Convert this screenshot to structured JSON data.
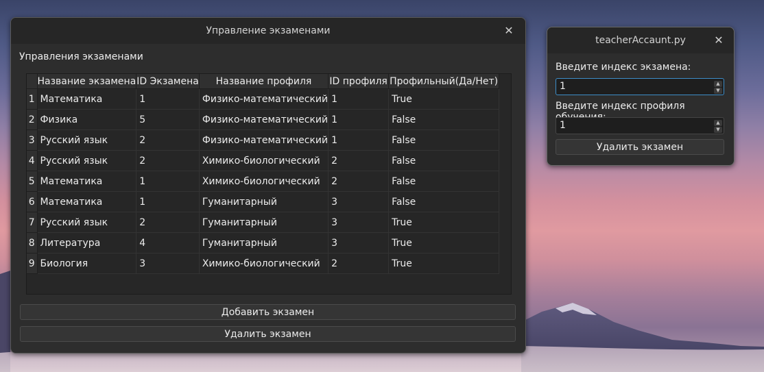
{
  "main_window": {
    "title": "Управление экзаменами",
    "close_glyph": "✕",
    "section_label": "Управления экзаменами",
    "table": {
      "columns": [
        "Название экзамена",
        "ID Экзамена",
        "Название профиля",
        "ID профиля",
        "Профильный(Да/Нет)"
      ],
      "rows": [
        {
          "num": "1",
          "cells": [
            "Математика",
            "1",
            "Физико-математический",
            "1",
            "True"
          ]
        },
        {
          "num": "2",
          "cells": [
            "Физика",
            "5",
            "Физико-математический",
            "1",
            "False"
          ]
        },
        {
          "num": "3",
          "cells": [
            "Русский язык",
            "2",
            "Физико-математический",
            "1",
            "False"
          ]
        },
        {
          "num": "4",
          "cells": [
            "Русский язык",
            "2",
            "Химико-биологический",
            "2",
            "False"
          ]
        },
        {
          "num": "5",
          "cells": [
            "Математика",
            "1",
            "Химико-биологический",
            "2",
            "False"
          ]
        },
        {
          "num": "6",
          "cells": [
            "Математика",
            "1",
            "Гуманитарный",
            "3",
            "False"
          ]
        },
        {
          "num": "7",
          "cells": [
            "Русский язык",
            "2",
            "Гуманитарный",
            "3",
            "True"
          ]
        },
        {
          "num": "8",
          "cells": [
            "Литература",
            "4",
            "Гуманитарный",
            "3",
            "True"
          ]
        },
        {
          "num": "9",
          "cells": [
            "Биология",
            "3",
            "Химико-биологический",
            "2",
            "True"
          ]
        }
      ]
    },
    "add_button": "Добавить экзамен",
    "delete_button": "Удалить экзамен"
  },
  "side_window": {
    "title": "teacherAccaunt.py",
    "close_glyph": "✕",
    "exam_index_label": "Введите индекс экзамена:",
    "exam_index_value": "1",
    "profile_index_label": "Введите индекс профиля обучения:",
    "profile_index_value": "1",
    "delete_button": "Удалить экзамен",
    "arrow_up": "▲",
    "arrow_down": "▼"
  },
  "colors": {
    "window_bg": "#2d2d2d",
    "titlebar_bg": "#262626",
    "focus_accent": "#3d8ec9"
  }
}
